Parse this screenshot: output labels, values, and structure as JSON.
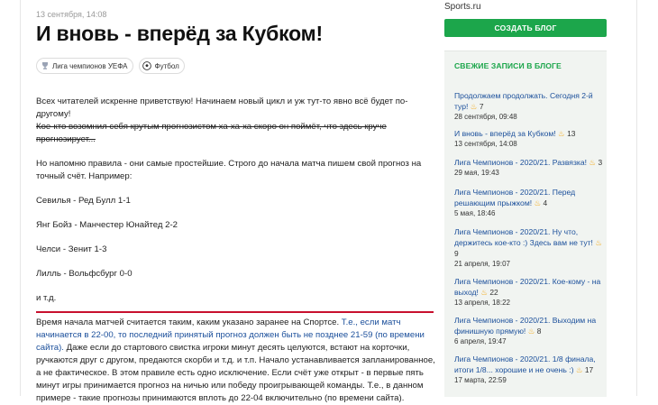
{
  "article": {
    "date": "13 сентября, 14:08",
    "title": "И вновь - вперёд за Кубком!",
    "tags": [
      {
        "label": "Лига чемпионов УЕФА",
        "icon": "trophy-icon"
      },
      {
        "label": "Футбол",
        "icon": "ball-icon"
      }
    ],
    "p1": "Всех читателей искренне приветствую! Начинаем новый цикл и уж тут-то явно всё будет по-другому!",
    "p1_strike": "Кое-кто возомнил себя крутым прогнозистом ха-ха-ха скоро он поймёт, что здесь круче прогнозирует...",
    "p2": "Но напомню правила - они самые простейшие. Строго до начала матча пишем свой прогноз на точный счёт. Например:",
    "matches": [
      "Севилья - Ред Булл 1-1",
      "Янг Бойз - Манчестер Юнайтед 2-2",
      "Челси - Зенит 1-3",
      "Лилль - Вольфсбург 0-0"
    ],
    "etc": "и т.д.",
    "p3_start": "Время начала матчей считается таким, каким указано заранее на Спортсе. ",
    "p3_highlight": "Т.е., если матч начинается в 22-00, то последний принятый прогноз должен быть не позднее 21-59 (по времени сайта).",
    "p3_end": " Даже если до стартового свистка игроки минут десять целуются, встают на корточки, ручкаются друг с другом, предаются скорби и т.д. и т.п. Начало устанавливается запланированное, а не фактическое. В этом правиле есть одно исключение. Если счёт уже открыт - в первые пять минут игры принимается прогноз на ничью или победу проигрывающей команды. Т.е., в данном примере - такие прогнозы принимаются вплоть до 22-04 включительно (по времени сайта)."
  },
  "sidebar": {
    "brand": "Sports.ru",
    "create_button": "СОЗДАТЬ БЛОГ",
    "recent_title": "СВЕЖИЕ ЗАПИСИ В БЛОГЕ",
    "entries": [
      {
        "title": "Продолжаем продолжать. Сегодня 2-й тур!",
        "count": "7",
        "date": "28 сентября, 09:48"
      },
      {
        "title": "И вновь - вперёд за Кубком!",
        "count": "13",
        "date": "13 сентября, 14:08"
      },
      {
        "title": "Лига Чемпионов - 2020/21. Развязка!",
        "count": "3",
        "date": "29 мая, 19:43"
      },
      {
        "title": "Лига Чемпионов - 2020/21. Перед решающим прыжком!",
        "count": "4",
        "date": "5 мая, 18:46"
      },
      {
        "title": "Лига Чемпионов - 2020/21. Ну что, держитесь кое-кто :) Здесь вам не тут!",
        "count": "9",
        "date": "21 апреля, 19:07"
      },
      {
        "title": "Лига Чемпионов - 2020/21. Кое-кому - на выход!",
        "count": "22",
        "date": "13 апреля, 18:22"
      },
      {
        "title": "Лига Чемпионов - 2020/21. Выходим на финишную прямую!",
        "count": "8",
        "date": "6 апреля, 19:47"
      },
      {
        "title": "Лига Чемпионов - 2020/21. 1/8 финала, итоги 1/8... хорошие и не очень :)",
        "count": "17",
        "date": "17 марта, 22:59"
      }
    ]
  }
}
